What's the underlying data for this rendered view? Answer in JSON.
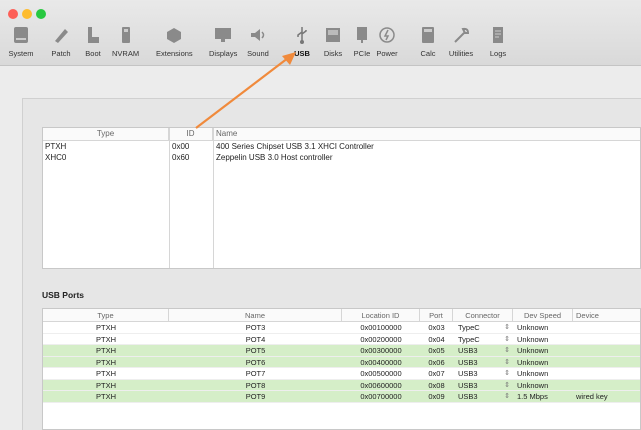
{
  "toolbar": {
    "items": [
      {
        "label": "System",
        "icon": "hard-drive-icon"
      },
      {
        "label": "Patch",
        "icon": "pencil-icon"
      },
      {
        "label": "Boot",
        "icon": "boot-icon"
      },
      {
        "label": "NVRAM",
        "icon": "nvram-icon"
      },
      {
        "label": "Extensions",
        "icon": "puzzle-icon"
      },
      {
        "label": "Displays",
        "icon": "monitor-icon"
      },
      {
        "label": "Sound",
        "icon": "speaker-icon"
      },
      {
        "label": "USB",
        "icon": "usb-icon"
      },
      {
        "label": "Disks",
        "icon": "disk-icon"
      },
      {
        "label": "PCIe",
        "icon": "pcie-icon"
      },
      {
        "label": "Power",
        "icon": "power-icon"
      },
      {
        "label": "Calc",
        "icon": "calculator-icon"
      },
      {
        "label": "Utilities",
        "icon": "wrench-icon"
      },
      {
        "label": "Logs",
        "icon": "logs-icon"
      }
    ],
    "active": "USB"
  },
  "controllers": {
    "headers": {
      "type": "Type",
      "id": "ID",
      "name": "Name"
    },
    "rows": [
      {
        "type": "PTXH",
        "id": "0x00",
        "name": "400 Series Chipset USB 3.1 XHCI Controller"
      },
      {
        "type": "XHC0",
        "id": "0x60",
        "name": "Zeppelin USB 3.0 Host controller"
      }
    ]
  },
  "usb_ports": {
    "title": "USB Ports",
    "headers": {
      "type": "Type",
      "name": "Name",
      "location": "Location ID",
      "port": "Port",
      "connector": "Connector",
      "speed": "Dev Speed",
      "device": "Device"
    },
    "rows": [
      {
        "type": "PTXH",
        "name": "POT3",
        "location": "0x00100000",
        "port": "0x03",
        "connector": "TypeC",
        "speed": "Unknown",
        "device": "",
        "highlight": false
      },
      {
        "type": "PTXH",
        "name": "POT4",
        "location": "0x00200000",
        "port": "0x04",
        "connector": "TypeC",
        "speed": "Unknown",
        "device": "",
        "highlight": false
      },
      {
        "type": "PTXH",
        "name": "POT5",
        "location": "0x00300000",
        "port": "0x05",
        "connector": "USB3",
        "speed": "Unknown",
        "device": "",
        "highlight": true
      },
      {
        "type": "PTXH",
        "name": "POT6",
        "location": "0x00400000",
        "port": "0x06",
        "connector": "USB3",
        "speed": "Unknown",
        "device": "",
        "highlight": true
      },
      {
        "type": "PTXH",
        "name": "POT7",
        "location": "0x00500000",
        "port": "0x07",
        "connector": "USB3",
        "speed": "Unknown",
        "device": "",
        "highlight": false
      },
      {
        "type": "PTXH",
        "name": "POT8",
        "location": "0x00600000",
        "port": "0x08",
        "connector": "USB3",
        "speed": "Unknown",
        "device": "",
        "highlight": true
      },
      {
        "type": "PTXH",
        "name": "POT9",
        "location": "0x00700000",
        "port": "0x09",
        "connector": "USB3",
        "speed": "1.5 Mbps",
        "device": "wired key",
        "highlight": true
      }
    ]
  },
  "colors": {
    "highlight_row": "#d5eec8",
    "annotation_arrow": "#f08a3c"
  }
}
